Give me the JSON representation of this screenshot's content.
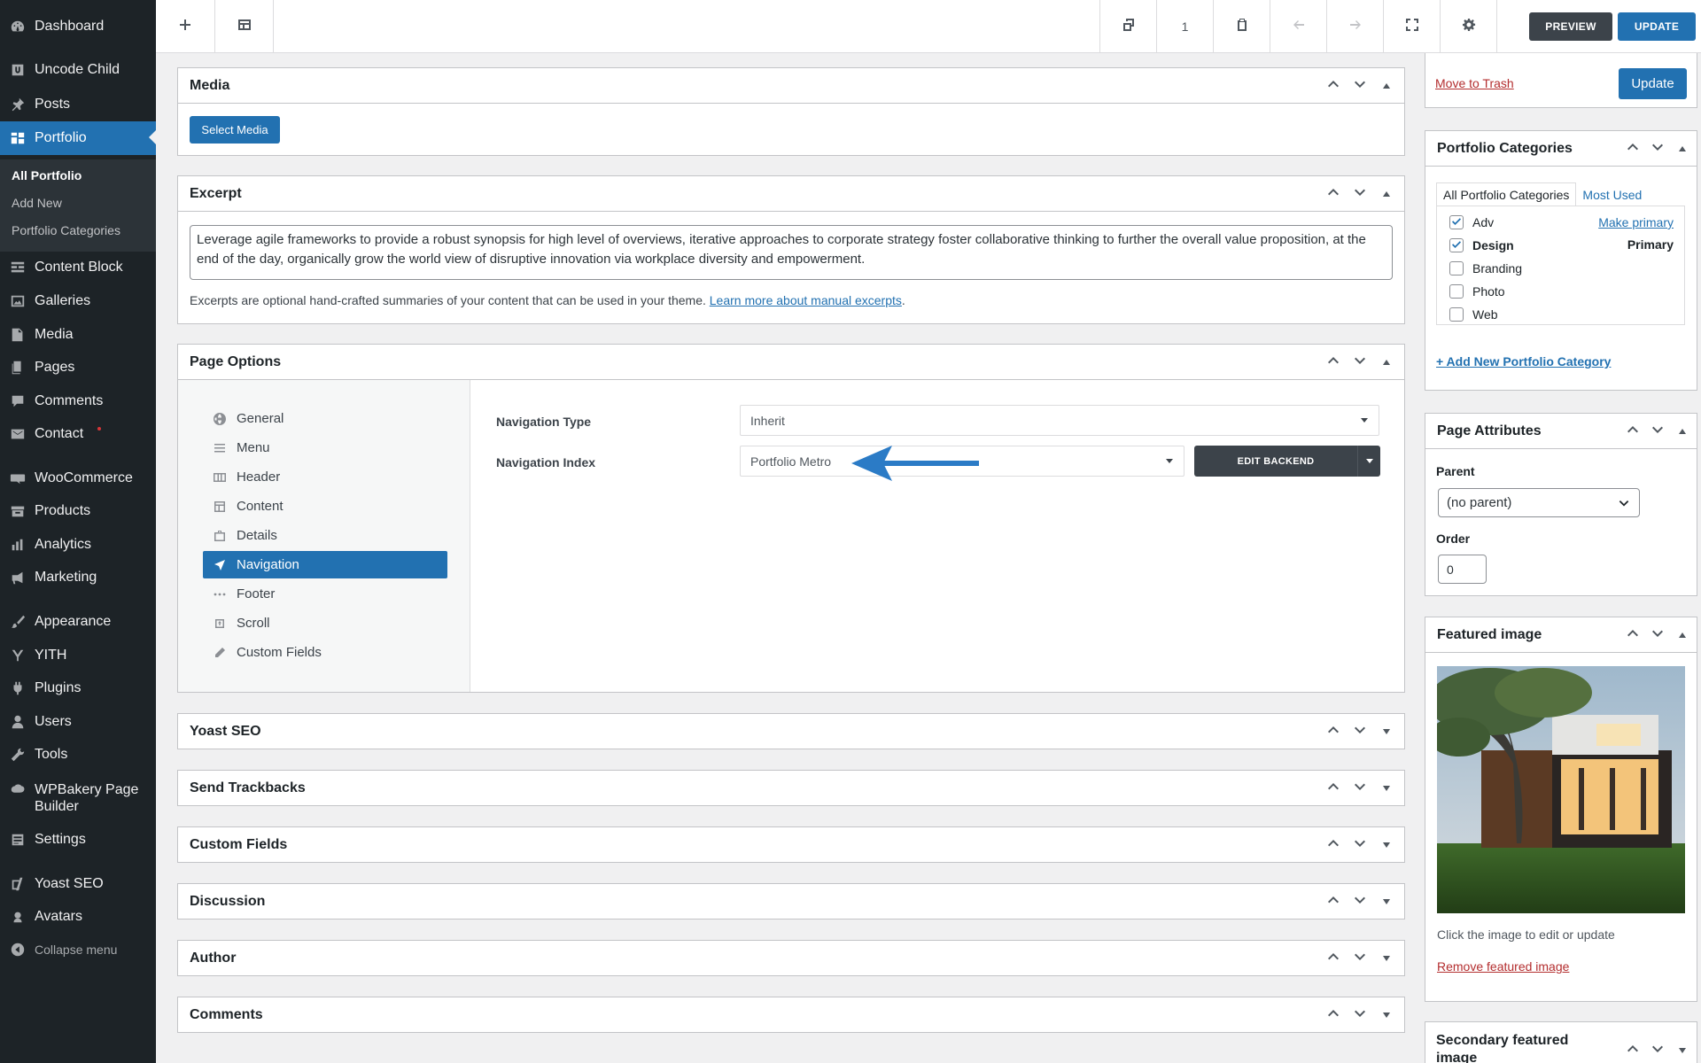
{
  "sidebar": {
    "items": [
      {
        "label": "Dashboard",
        "icon": "dashboard-icon"
      },
      {
        "label": "Uncode Child",
        "icon": "uncode-icon"
      },
      {
        "label": "Posts",
        "icon": "pin-icon"
      },
      {
        "label": "Portfolio",
        "icon": "portfolio-icon"
      },
      {
        "label": "Content Block",
        "icon": "content-block-icon"
      },
      {
        "label": "Galleries",
        "icon": "gallery-icon"
      },
      {
        "label": "Media",
        "icon": "media-icon"
      },
      {
        "label": "Pages",
        "icon": "pages-icon"
      },
      {
        "label": "Comments",
        "icon": "comments-icon"
      },
      {
        "label": "Contact",
        "icon": "mail-icon"
      },
      {
        "label": "WooCommerce",
        "icon": "woo-icon"
      },
      {
        "label": "Products",
        "icon": "products-icon"
      },
      {
        "label": "Analytics",
        "icon": "analytics-icon"
      },
      {
        "label": "Marketing",
        "icon": "megaphone-icon"
      },
      {
        "label": "Appearance",
        "icon": "brush-icon"
      },
      {
        "label": "YITH",
        "icon": "yith-icon"
      },
      {
        "label": "Plugins",
        "icon": "plugins-icon"
      },
      {
        "label": "Users",
        "icon": "users-icon"
      },
      {
        "label": "Tools",
        "icon": "wrench-icon"
      },
      {
        "label": "WPBakery Page Builder",
        "icon": "wpbakery-icon"
      },
      {
        "label": "Settings",
        "icon": "settings-icon"
      },
      {
        "label": "Yoast SEO",
        "icon": "yoast-icon"
      },
      {
        "label": "Avatars",
        "icon": "avatar-icon"
      }
    ],
    "submenu": [
      "All Portfolio",
      "Add New",
      "Portfolio Categories"
    ],
    "collapse_label": "Collapse menu"
  },
  "toolbar": {
    "page_count": "1",
    "preview_label": "PREVIEW",
    "update_label": "UPDATE"
  },
  "media_box": {
    "title": "Media",
    "select_label": "Select Media"
  },
  "excerpt_box": {
    "title": "Excerpt",
    "text": "Leverage agile frameworks to provide a robust synopsis for high level of overviews, iterative approaches to corporate strategy foster collaborative thinking to further the overall value proposition, at the end of the day, organically grow the world view of disruptive innovation via workplace diversity and empowerment.",
    "help_text": "Excerpts are optional hand-crafted summaries of your content that can be used in your theme.",
    "help_link": "Learn more about manual excerpts",
    "help_end": "."
  },
  "page_options": {
    "title": "Page Options",
    "nav_items": [
      {
        "label": "General",
        "icon": "globe-icon"
      },
      {
        "label": "Menu",
        "icon": "menu-icon"
      },
      {
        "label": "Header",
        "icon": "header-icon"
      },
      {
        "label": "Content",
        "icon": "content-icon"
      },
      {
        "label": "Details",
        "icon": "briefcase-icon"
      },
      {
        "label": "Navigation",
        "icon": "navigation-icon"
      },
      {
        "label": "Footer",
        "icon": "dots-icon"
      },
      {
        "label": "Scroll",
        "icon": "scroll-icon"
      },
      {
        "label": "Custom Fields",
        "icon": "pencil-icon"
      }
    ],
    "active_nav": "Navigation",
    "navigation_type_label": "Navigation Type",
    "navigation_type_value": "Inherit",
    "navigation_index_label": "Navigation Index",
    "navigation_index_value": "Portfolio Metro",
    "edit_backend_label": "EDIT BACKEND",
    "annotation_color": "#2b7bc6"
  },
  "closed_boxes": [
    "Yoast SEO",
    "Send Trackbacks",
    "Custom Fields",
    "Discussion",
    "Author",
    "Comments"
  ],
  "publish_box": {
    "trash_label": "Move to Trash",
    "update_label": "Update"
  },
  "categories_box": {
    "title": "Portfolio Categories",
    "tab_all": "All Portfolio Categories",
    "tab_used": "Most Used",
    "items": [
      {
        "label": "Adv",
        "checked": true
      },
      {
        "label": "Design",
        "checked": true
      },
      {
        "label": "Branding",
        "checked": false
      },
      {
        "label": "Photo",
        "checked": false
      },
      {
        "label": "Web",
        "checked": false
      }
    ],
    "make_primary_label": "Make primary",
    "primary_label": "Primary",
    "add_new_label": "+ Add New Portfolio Category"
  },
  "attributes_box": {
    "title": "Page Attributes",
    "parent_label": "Parent",
    "parent_value": "(no parent)",
    "order_label": "Order",
    "order_value": "0"
  },
  "featured_box": {
    "title": "Featured image",
    "hint": "Click the image to edit or update",
    "remove_label": "Remove featured image"
  },
  "secondary_box": {
    "title": "Secondary featured image"
  },
  "colors": {
    "admin_bg": "#1d2327",
    "accent": "#2271b1",
    "danger": "#b32d2e"
  }
}
